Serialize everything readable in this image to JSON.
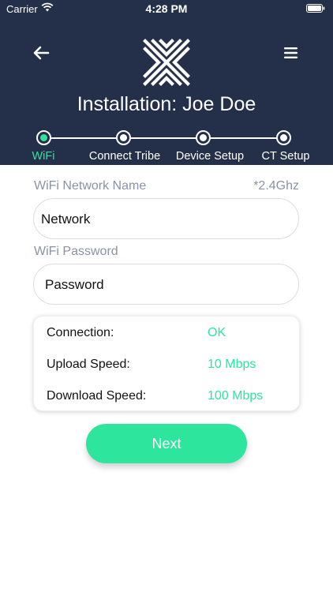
{
  "status_bar": {
    "carrier": "Carrier",
    "time": "4:28 PM"
  },
  "header": {
    "title": "Installation: Joe Doe",
    "back_icon": "arrow-left-icon",
    "menu_icon": "hamburger-menu-icon",
    "logo": "x-chevron-logo"
  },
  "steps": [
    {
      "label": "WiFi",
      "active": true
    },
    {
      "label": "Connect Tribe",
      "active": false
    },
    {
      "label": "Device Setup",
      "active": false
    },
    {
      "label": "CT Setup",
      "active": false
    }
  ],
  "form": {
    "network_label": "WiFi Network Name",
    "network_hint": "*2.4Ghz",
    "network_value": "Network",
    "password_label": "WiFi Password",
    "password_value": "Password"
  },
  "status": [
    {
      "key": "Connection:",
      "value": "OK"
    },
    {
      "key": "Upload Speed:",
      "value": "10 Mbps"
    },
    {
      "key": "Download Speed:",
      "value": "100 Mbps"
    }
  ],
  "next_label": "Next",
  "colors": {
    "header_bg": "#243049",
    "accent": "#2ee59d",
    "label_gray": "#8a93a3"
  }
}
